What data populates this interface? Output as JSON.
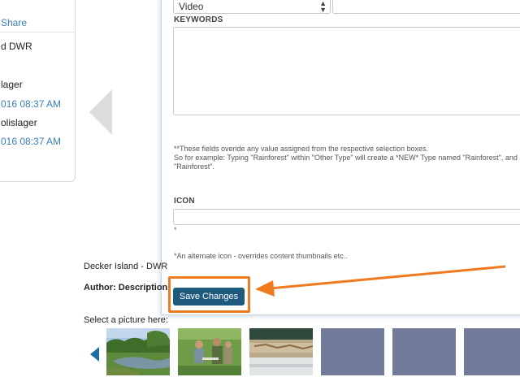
{
  "info_card": {
    "share_label": "Share",
    "line1": "d DWR",
    "line2": "lager",
    "date1": "016 08:37 AM",
    "line3": "olislager",
    "date2": "016 08:37 AM"
  },
  "form": {
    "type_select_value": "Video",
    "keywords_label": "KEYWORDS",
    "override_note_line1": "**These fields overide any value assigned from the respective selection boxes.",
    "override_note_line2": "So for example: Typing \"Rainforest\" within \"Other Type\" will create a *NEW* Type named \"Rainforest\", and a",
    "override_note_line3": "\"Rainforest\".",
    "icon_label": "ICON",
    "icon_asterisk": "*",
    "icon_note": "*An alternate icon - overrides content thumbnails etc..",
    "save_button_label": "Save Changes"
  },
  "page": {
    "item_title": "Decker Island - DWR",
    "author_label": "Author: Description",
    "picture_prompt": "Select a picture here:"
  },
  "colors": {
    "accent_orange": "#f07a20",
    "button_blue": "#1e5a7d",
    "link_blue": "#3a7fb5",
    "placeholder_thumb": "#737b9a"
  },
  "icons": {
    "carousel_prev_large": "chevron-left-icon",
    "carousel_prev_small": "chevron-left-icon",
    "select_caret": "up-down-caret-icon"
  }
}
